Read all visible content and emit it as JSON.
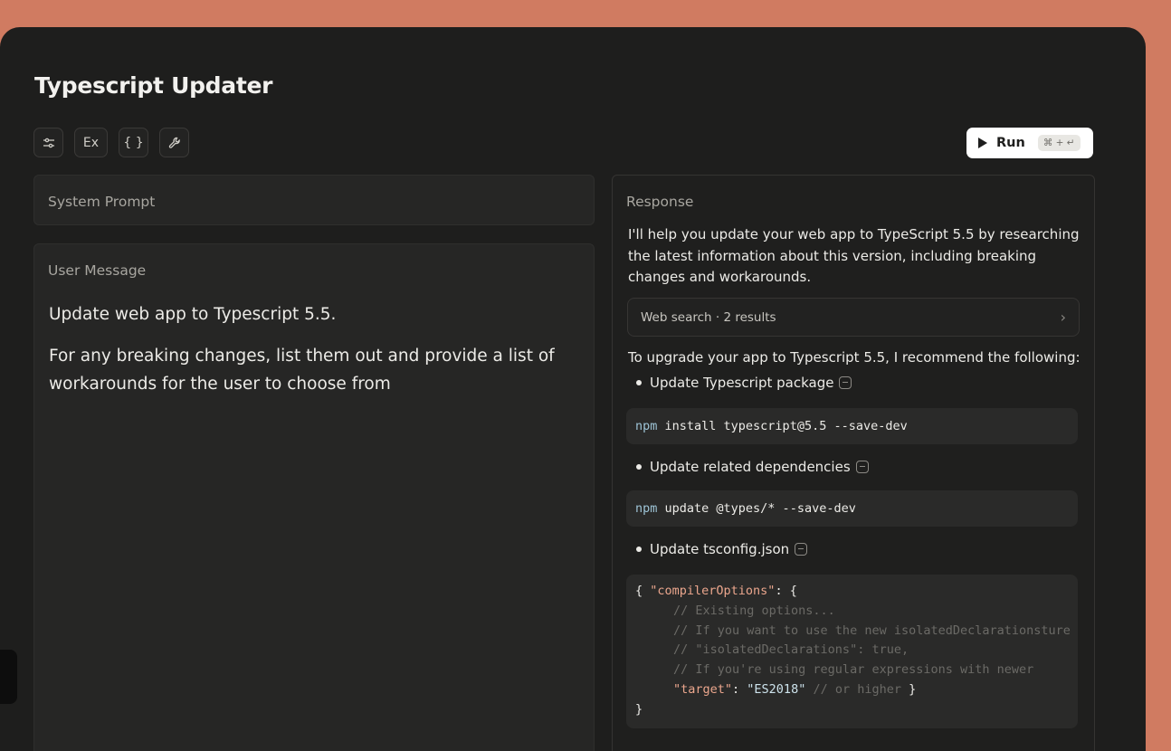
{
  "app": {
    "title": "Typescript Updater"
  },
  "toolbar": {
    "settings_icon": "sliders-icon",
    "examples_label": "Ex",
    "variables_label": "{ }",
    "tools_icon": "wrench-icon"
  },
  "run": {
    "label": "Run",
    "shortcut": "⌘ + ↵"
  },
  "system_prompt": {
    "label": "System Prompt"
  },
  "user_message": {
    "label": "User Message",
    "line1": "Update web app to Typescript 5.5.",
    "line2": "For any breaking changes, list them out and provide a list of workarounds for the user to choose from"
  },
  "response": {
    "label": "Response",
    "intro": "I'll help you update your web app to TypeScript 5.5 by researching the latest information about this version, including breaking changes and workarounds.",
    "web_search": "Web search · 2 results",
    "recommend": "To upgrade your app to Typescript 5.5, I recommend the following:",
    "steps": [
      {
        "label": "Update Typescript package",
        "cmd": "npm",
        "args": " install typescript@5.5 --save-dev"
      },
      {
        "label": "Update related dependencies",
        "cmd": "npm",
        "args": " update @types/* --save-dev"
      },
      {
        "label": "Update tsconfig.json"
      }
    ],
    "json_code": {
      "open": "{ ",
      "compiler_key": "\"compilerOptions\"",
      "compiler_after": ": {",
      "c1": "// Existing options...",
      "c2": "// If you want to use the new isolatedDeclarationsture",
      "c3": "// \"isolatedDeclarations\": true,",
      "c4": "// If you're using regular expressions with newer",
      "target_key": "\"target\"",
      "colon": ": ",
      "target_val": "\"ES2018\"",
      "c5": " // or higher",
      "close_inner": " }",
      "close": "}"
    }
  }
}
